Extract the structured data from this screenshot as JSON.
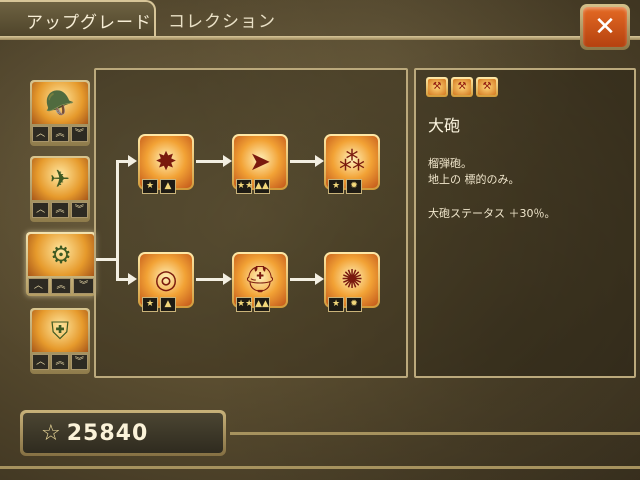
{
  "tabs": {
    "upgrade": "アップグレード",
    "collection": "コレクション"
  },
  "close": {
    "glyph": "✕"
  },
  "units": [
    {
      "name": "soldier-unit",
      "icon": "🪖",
      "ranks": [
        "︿",
        "︽",
        "︾"
      ]
    },
    {
      "name": "plane-unit",
      "icon": "✈",
      "ranks": [
        "︿",
        "︽",
        "︾"
      ]
    },
    {
      "name": "cannon-unit",
      "icon": "⚙",
      "ranks": [
        "︿",
        "︽",
        "︾"
      ]
    },
    {
      "name": "aa-gun-unit",
      "icon": "⛨",
      "ranks": [
        "︿",
        "︽",
        "︾"
      ]
    }
  ],
  "tree": {
    "row1": [
      {
        "name": "shell-upgrade",
        "icon": "✸",
        "badges": [
          "★",
          "▲"
        ]
      },
      {
        "name": "volley-upgrade",
        "icon": "➤",
        "badges": [
          "★★",
          "▲▲"
        ]
      },
      {
        "name": "barrage-upgrade",
        "icon": "⁂",
        "badges": [
          "★",
          "✹"
        ]
      }
    ],
    "row2": [
      {
        "name": "target-upgrade",
        "icon": "◎",
        "badges": [
          "★",
          "▲"
        ]
      },
      {
        "name": "helmet-upgrade",
        "icon": "⛑",
        "badges": [
          "★★",
          "▲▲"
        ]
      },
      {
        "name": "gold-upgrade",
        "icon": "✺",
        "badges": [
          "★",
          "✹"
        ]
      }
    ]
  },
  "info": {
    "icons": [
      "⚒",
      "⚒",
      "⚒"
    ],
    "title": "大砲",
    "desc_line1": "榴弾砲。",
    "desc_line2": "地上の 標的のみ。",
    "stat": "大砲ステータス ＋30％。"
  },
  "currency": {
    "star": "☆",
    "amount": "25840"
  },
  "colors": {
    "accent": "#e46a24",
    "frame": "#d7c598"
  }
}
